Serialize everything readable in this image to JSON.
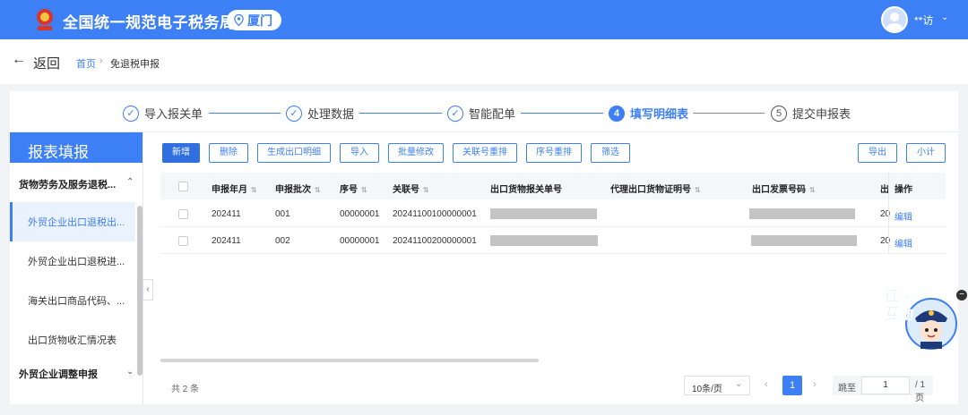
{
  "header": {
    "title": "全国统一规范电子税务局",
    "city": "厦门",
    "user": "**访"
  },
  "subheader": {
    "back_label": "返回",
    "breadcrumb_home": "首页",
    "breadcrumb_current": "免退税申报"
  },
  "steps": [
    {
      "num": "✓",
      "label": "导入报关单",
      "state": "done"
    },
    {
      "num": "✓",
      "label": "处理数据",
      "state": "done"
    },
    {
      "num": "✓",
      "label": "智能配单",
      "state": "done"
    },
    {
      "num": "4",
      "label": "填写明细表",
      "state": "active"
    },
    {
      "num": "5",
      "label": "提交申报表",
      "state": "pending"
    }
  ],
  "sidebar": {
    "title": "报表填报",
    "group1": "货物劳务及服务退税...",
    "items": [
      "外贸企业出口退税出...",
      "外贸企业出口退税进...",
      "海关出口商品代码、...",
      "出口货物收汇情况表"
    ],
    "group2": "外贸企业调整申报"
  },
  "toolbar": {
    "add": "新增",
    "delete": "删除",
    "generate": "生成出口明细",
    "import": "导入",
    "batch_edit": "批量修改",
    "relink": "关联号重排",
    "reseq": "序号重排",
    "filter": "筛选",
    "export": "导出",
    "subtotal": "小计"
  },
  "table": {
    "columns": [
      "申报年月",
      "申报批次",
      "序号",
      "关联号",
      "出口货物报关单号",
      "代理出口货物证明号",
      "出口发票号码",
      "出",
      "操作"
    ],
    "rows": [
      {
        "period": "202411",
        "batch": "001",
        "seq": "00000001",
        "link": "20241100100000001",
        "cut": "20",
        "action": "编辑"
      },
      {
        "period": "202411",
        "batch": "002",
        "seq": "00000001",
        "link": "20241100200000001",
        "cut": "20",
        "action": "编辑"
      }
    ]
  },
  "pagination": {
    "total": "共 2 条",
    "page_size": "10条/页",
    "prev": "‹",
    "current": "1",
    "next": "›",
    "jump_label": "跳至",
    "jump_value": "1",
    "total_pages": "/ 1 页"
  },
  "mascot": {
    "text": "征纳互动"
  },
  "colors": {
    "brand": "#3d7ff5",
    "primary_button": "#2f6fe0"
  }
}
